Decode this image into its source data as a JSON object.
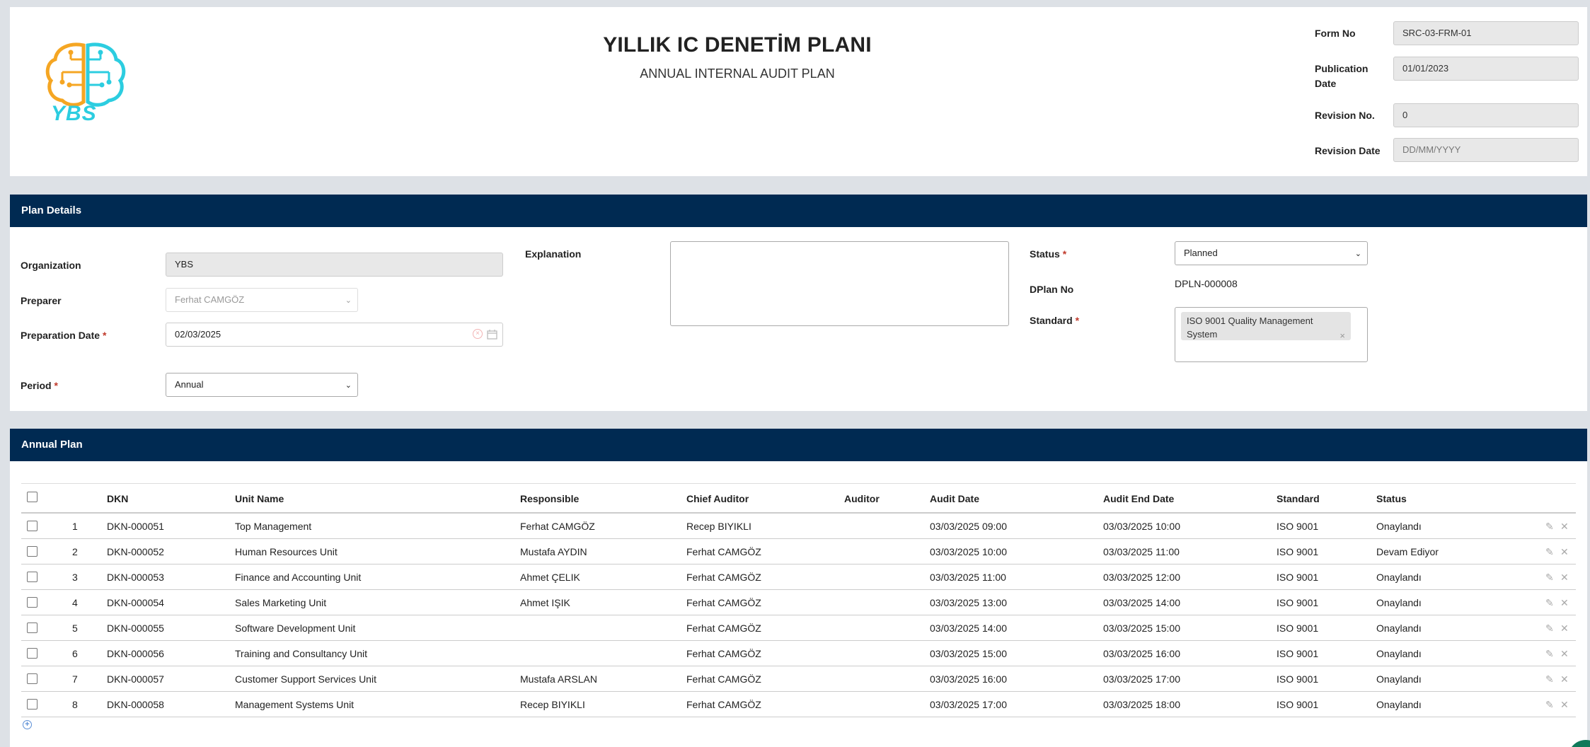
{
  "header": {
    "logo_text": "YBS",
    "title": "YILLIK IC DENETİM PLANI",
    "subtitle": "ANNUAL INTERNAL AUDIT PLAN",
    "form_no_label": "Form No",
    "form_no_value": "SRC-03-FRM-01",
    "publication_date_label": "Publication Date",
    "publication_date_value": "01/01/2023",
    "revision_no_label": "Revision No.",
    "revision_no_value": "0",
    "revision_date_label": "Revision Date",
    "revision_date_placeholder": "DD/MM/YYYY"
  },
  "plan_details": {
    "section_title": "Plan Details",
    "organization_label": "Organization",
    "organization_value": "YBS",
    "preparer_label": "Preparer",
    "preparer_value": "Ferhat CAMGÖZ",
    "preparation_date_label": "Preparation Date",
    "preparation_date_value": "02/03/2025",
    "period_label": "Period",
    "period_value": "Annual",
    "explanation_label": "Explanation",
    "explanation_value": "",
    "status_label": "Status",
    "status_value": "Planned",
    "dplan_no_label": "DPlan No",
    "dplan_no_value": "DPLN-000008",
    "standard_label": "Standard",
    "standard_tag": "ISO 9001 Quality Management System",
    "required_mark": "*"
  },
  "annual_plan": {
    "section_title": "Annual Plan",
    "columns": [
      "DKN",
      "Unit Name",
      "Responsible",
      "Chief Auditor",
      "Auditor",
      "Audit Date",
      "Audit End Date",
      "Standard",
      "Status"
    ],
    "rows": [
      {
        "no": "1",
        "dkn": "DKN-000051",
        "unit": "Top Management",
        "responsible": "Ferhat CAMGÖZ",
        "chief": "Recep BIYIKLI",
        "auditor": "",
        "start": "03/03/2025 09:00",
        "end": "03/03/2025 10:00",
        "standard": "ISO 9001",
        "status": "Onaylandı"
      },
      {
        "no": "2",
        "dkn": "DKN-000052",
        "unit": "Human Resources Unit",
        "responsible": "Mustafa AYDIN",
        "chief": "Ferhat CAMGÖZ",
        "auditor": "",
        "start": "03/03/2025 10:00",
        "end": "03/03/2025 11:00",
        "standard": "ISO 9001",
        "status": "Devam Ediyor"
      },
      {
        "no": "3",
        "dkn": "DKN-000053",
        "unit": "Finance and Accounting Unit",
        "responsible": "Ahmet ÇELIK",
        "chief": "Ferhat CAMGÖZ",
        "auditor": "",
        "start": "03/03/2025 11:00",
        "end": "03/03/2025 12:00",
        "standard": "ISO 9001",
        "status": "Onaylandı"
      },
      {
        "no": "4",
        "dkn": "DKN-000054",
        "unit": "Sales Marketing Unit",
        "responsible": "Ahmet IŞIK",
        "chief": "Ferhat CAMGÖZ",
        "auditor": "",
        "start": "03/03/2025 13:00",
        "end": "03/03/2025 14:00",
        "standard": "ISO 9001",
        "status": "Onaylandı"
      },
      {
        "no": "5",
        "dkn": "DKN-000055",
        "unit": "Software Development Unit",
        "responsible": "",
        "chief": "Ferhat CAMGÖZ",
        "auditor": "",
        "start": "03/03/2025 14:00",
        "end": "03/03/2025 15:00",
        "standard": "ISO 9001",
        "status": "Onaylandı"
      },
      {
        "no": "6",
        "dkn": "DKN-000056",
        "unit": "Training and Consultancy Unit",
        "responsible": "",
        "chief": "Ferhat CAMGÖZ",
        "auditor": "",
        "start": "03/03/2025 15:00",
        "end": "03/03/2025 16:00",
        "standard": "ISO 9001",
        "status": "Onaylandı"
      },
      {
        "no": "7",
        "dkn": "DKN-000057",
        "unit": "Customer Support Services Unit",
        "responsible": "Mustafa ARSLAN",
        "chief": "Ferhat CAMGÖZ",
        "auditor": "",
        "start": "03/03/2025 16:00",
        "end": "03/03/2025 17:00",
        "standard": "ISO 9001",
        "status": "Onaylandı"
      },
      {
        "no": "8",
        "dkn": "DKN-000058",
        "unit": "Management Systems Unit",
        "responsible": "Recep BIYIKLI",
        "chief": "Ferhat CAMGÖZ",
        "auditor": "",
        "start": "03/03/2025 17:00",
        "end": "03/03/2025 18:00",
        "standard": "ISO 9001",
        "status": "Onaylandı"
      }
    ]
  },
  "colors": {
    "section_bar": "#002a52",
    "logo_orange": "#f5a623",
    "logo_cyan": "#2ccde0"
  }
}
